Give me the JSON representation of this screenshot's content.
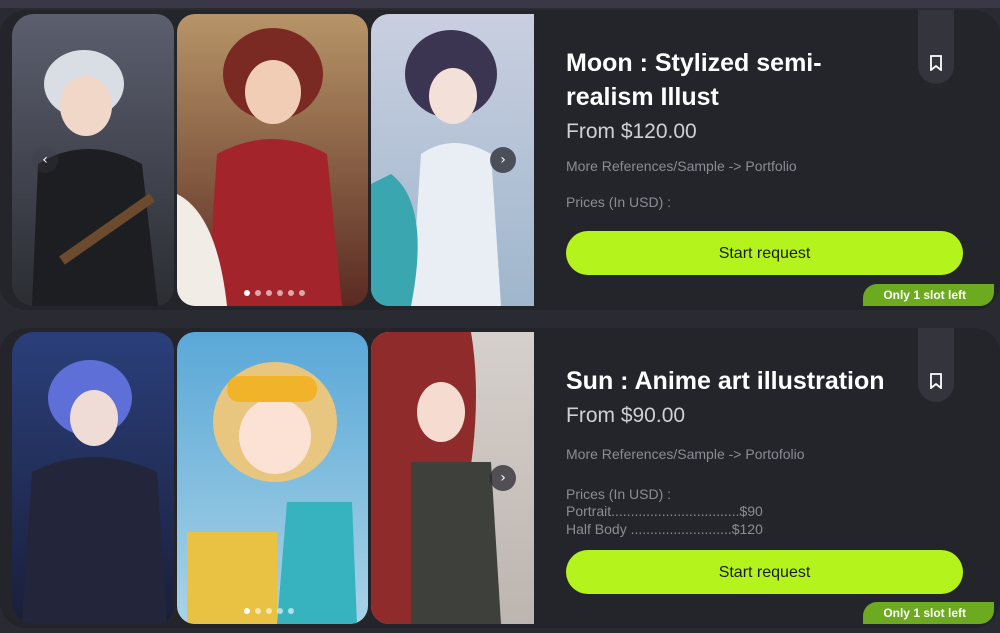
{
  "cards": [
    {
      "title": "Moon : Stylized semi-realism Illust",
      "price": "From $120.00",
      "references": "More References/Sample -> Portfolio",
      "prices_heading": "Prices (In USD) :",
      "price_lines": [],
      "button_label": "Start request",
      "slot_badge": "Only 1 slot left",
      "carousel_prev_icon": "‹",
      "carousel_next_icon": "›",
      "carousel_pages": 6,
      "carousel_active_page": 1
    },
    {
      "title": "Sun : Anime art illustration",
      "price": "From $90.00",
      "references": "More References/Sample -> Portofolio",
      "prices_heading": "Prices (In USD) :",
      "price_lines": [
        "Portrait.................................$90",
        "Half Body ..........................$120"
      ],
      "button_label": "Start request",
      "slot_badge": "Only 1 slot left",
      "carousel_next_icon": "›",
      "carousel_pages": 5,
      "carousel_active_page": 1
    }
  ],
  "colors": {
    "accent_button": "#b4f31c",
    "badge_green": "#6cab1f",
    "card_bg": "#24242b"
  }
}
